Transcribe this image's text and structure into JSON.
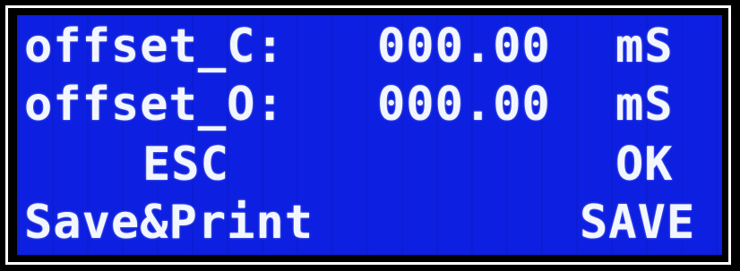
{
  "display": {
    "row1": {
      "label": "offset_C:",
      "value": "000.00",
      "unit": "mS"
    },
    "row2": {
      "label": "offset_O:",
      "value": "000.00",
      "unit": "mS"
    },
    "row3": {
      "esc_label": "ESC",
      "ok_label": "OK"
    },
    "row4": {
      "save_print_label": "Save&Print",
      "save_label": "SAVE"
    }
  },
  "colors": {
    "lcd_background": "#0d1fe0",
    "lcd_text": "#f2f6ff",
    "frame": "#ffffff"
  }
}
